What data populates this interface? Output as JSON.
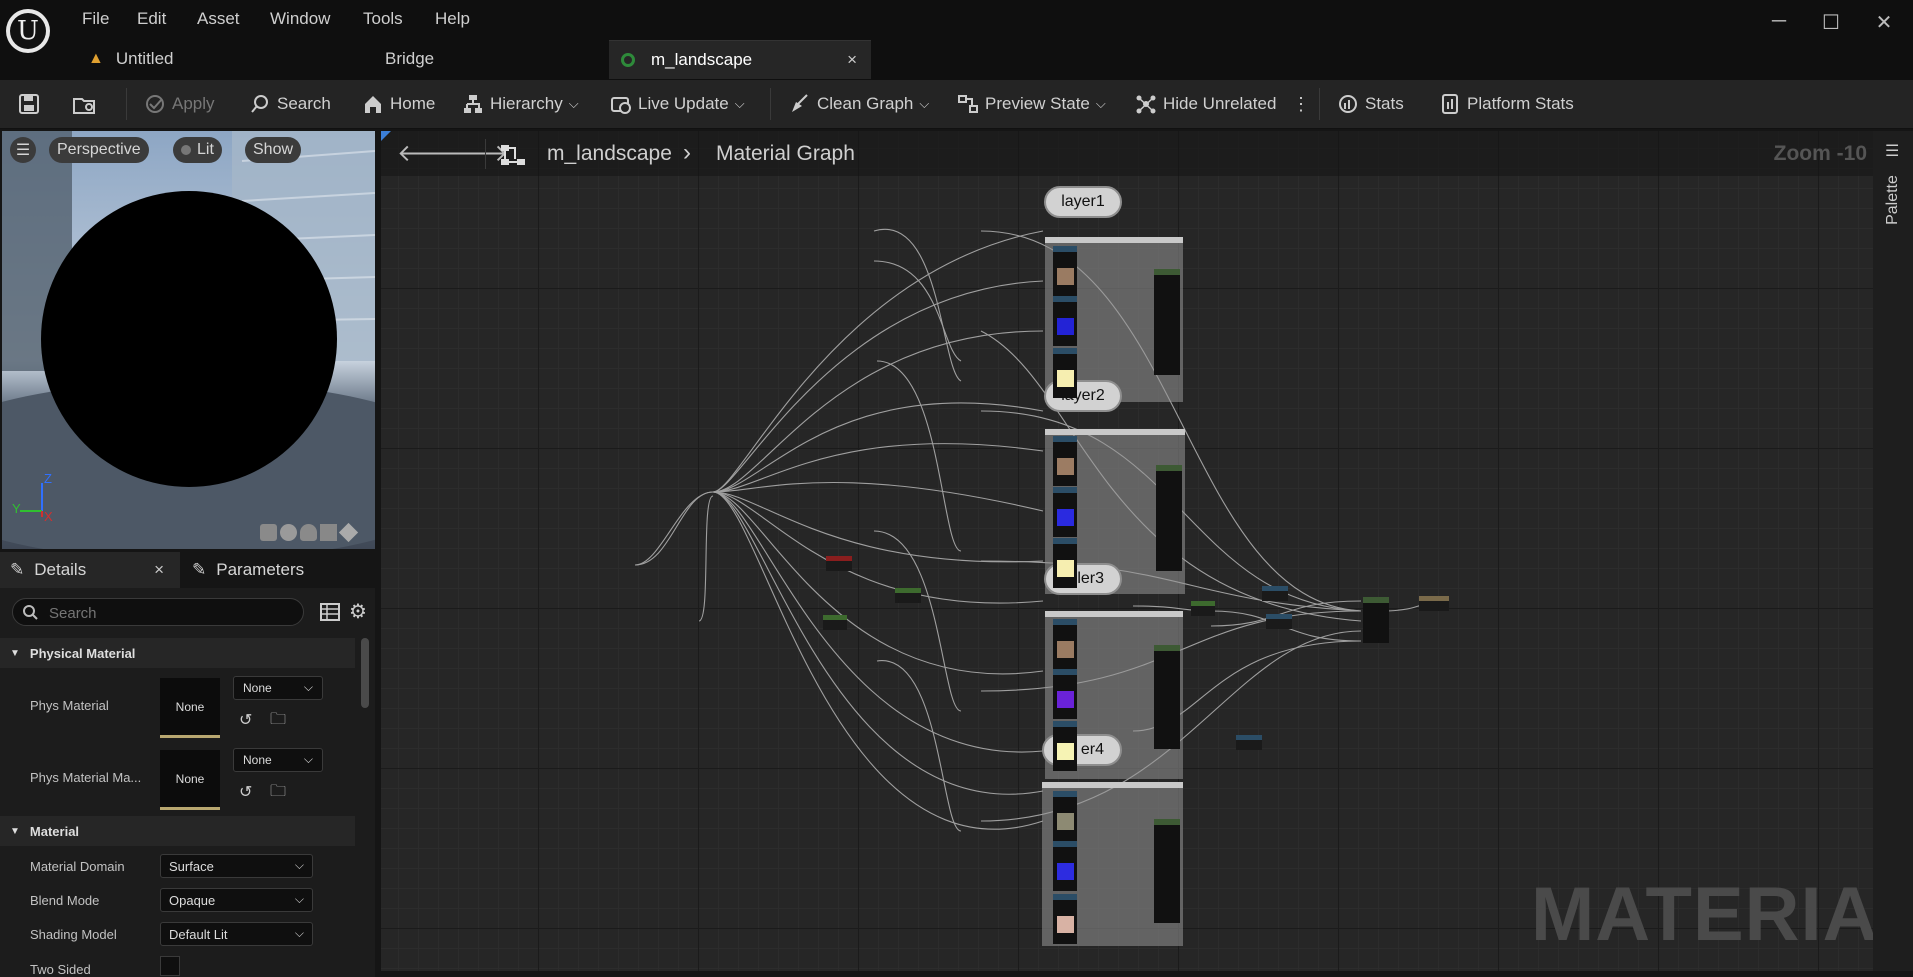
{
  "menu": {
    "items": [
      "File",
      "Edit",
      "Asset",
      "Window",
      "Tools",
      "Help"
    ]
  },
  "tabs": [
    {
      "label": "Untitled"
    },
    {
      "label": "Bridge"
    },
    {
      "label": "m_landscape",
      "close": "×"
    }
  ],
  "window_controls": {
    "minimize": "─",
    "maximize": "☐",
    "close": "✕"
  },
  "toolbar": {
    "apply": "Apply",
    "search": "Search",
    "home": "Home",
    "hierarchy": "Hierarchy",
    "live_update": "Live Update",
    "clean_graph": "Clean Graph",
    "preview_state": "Preview State",
    "hide_unrelated": "Hide Unrelated",
    "stats": "Stats",
    "platform_stats": "Platform Stats"
  },
  "viewport": {
    "perspective": "Perspective",
    "lit": "Lit",
    "show": "Show",
    "axis_z": "Z",
    "axis_y": "Y",
    "axis_x": "X"
  },
  "details": {
    "tab_details": "Details",
    "tab_close": "×",
    "tab_parameters": "Parameters",
    "search_placeholder": "Search",
    "section_physical": "Physical Material",
    "phys_material_label": "Phys Material",
    "phys_material_value": "None",
    "phys_material_combo": "None",
    "phys_material_mask_label": "Phys Material Ma...",
    "phys_material_mask_value": "None",
    "phys_material_mask_combo": "None",
    "section_material": "Material",
    "material_domain_label": "Material Domain",
    "material_domain_value": "Surface",
    "blend_mode_label": "Blend Mode",
    "blend_mode_value": "Opaque",
    "shading_model_label": "Shading Model",
    "shading_model_value": "Default Lit",
    "two_sided_label": "Two Sided"
  },
  "graph": {
    "breadcrumb_asset": "m_landscape",
    "breadcrumb_sep": "›",
    "breadcrumb_graph": "Material Graph",
    "zoom": "Zoom -10",
    "watermark": "MATERIAL",
    "palette": "Palette",
    "comments": [
      {
        "label": "layer1"
      },
      {
        "label": "layer2"
      },
      {
        "label": "ler3"
      },
      {
        "label": "er4"
      }
    ]
  },
  "colors": {
    "accent_tab": "#2e8a3a",
    "warning_icon": "#e0a030",
    "axis_x": "#d03030",
    "axis_y": "#30c030",
    "axis_z": "#3070ff"
  }
}
